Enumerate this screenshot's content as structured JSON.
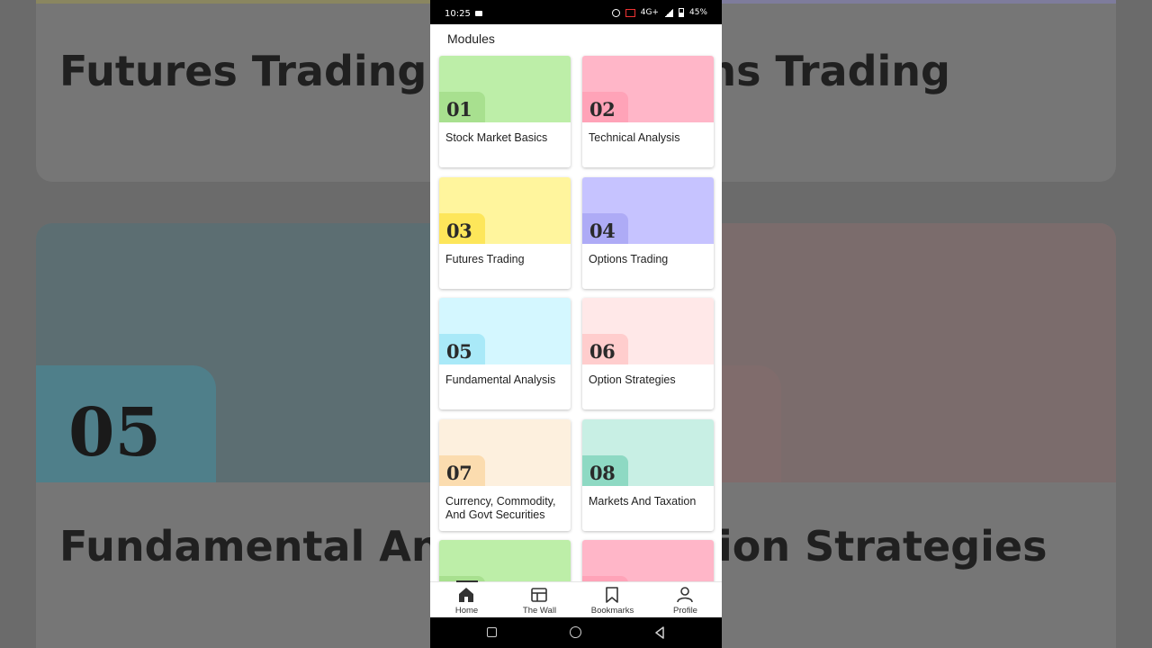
{
  "status_bar": {
    "time": "10:25",
    "battery": "45%",
    "network": "4G+"
  },
  "page_title": "Modules",
  "modules": [
    {
      "number": "01",
      "title": "Stock Market Basics",
      "top_color": "#bdeea8",
      "tab_color": "#a8e08f"
    },
    {
      "number": "02",
      "title": "Technical Analysis",
      "top_color": "#ffb6c8",
      "tab_color": "#ffa3b8"
    },
    {
      "number": "03",
      "title": "Futures Trading",
      "top_color": "#fff59d",
      "tab_color": "#fde65a"
    },
    {
      "number": "04",
      "title": "Options Trading",
      "top_color": "#c6c3ff",
      "tab_color": "#aeabf6"
    },
    {
      "number": "05",
      "title": "Fundamental Analysis",
      "top_color": "#d4f7ff",
      "tab_color": "#a9e9f8"
    },
    {
      "number": "06",
      "title": "Option Strategies",
      "top_color": "#ffe8e8",
      "tab_color": "#ffcdcd"
    },
    {
      "number": "07",
      "title": "Currency, Commodity, And Govt Securities",
      "top_color": "#fdf0de",
      "tab_color": "#fbdcaf"
    },
    {
      "number": "08",
      "title": "Markets And Taxation",
      "top_color": "#c8efe4",
      "tab_color": "#8ed9c3"
    },
    {
      "number": "",
      "title": "",
      "top_color": "#bdeea8",
      "tab_color": "#a8e08f"
    },
    {
      "number": "",
      "title": "",
      "top_color": "#ffb6c8",
      "tab_color": "#ffa3b8"
    }
  ],
  "bottom_nav": [
    {
      "label": "Home",
      "icon": "home-icon"
    },
    {
      "label": "The Wall",
      "icon": "wall-icon"
    },
    {
      "label": "Bookmarks",
      "icon": "bookmark-icon"
    },
    {
      "label": "Profile",
      "icon": "profile-icon"
    }
  ],
  "background": {
    "cards": [
      {
        "title": "Futures Trading"
      },
      {
        "title": "Options Trading"
      },
      {
        "title": "Fundamental Analysis",
        "number": "05"
      },
      {
        "title": "Option Strategies"
      }
    ]
  }
}
